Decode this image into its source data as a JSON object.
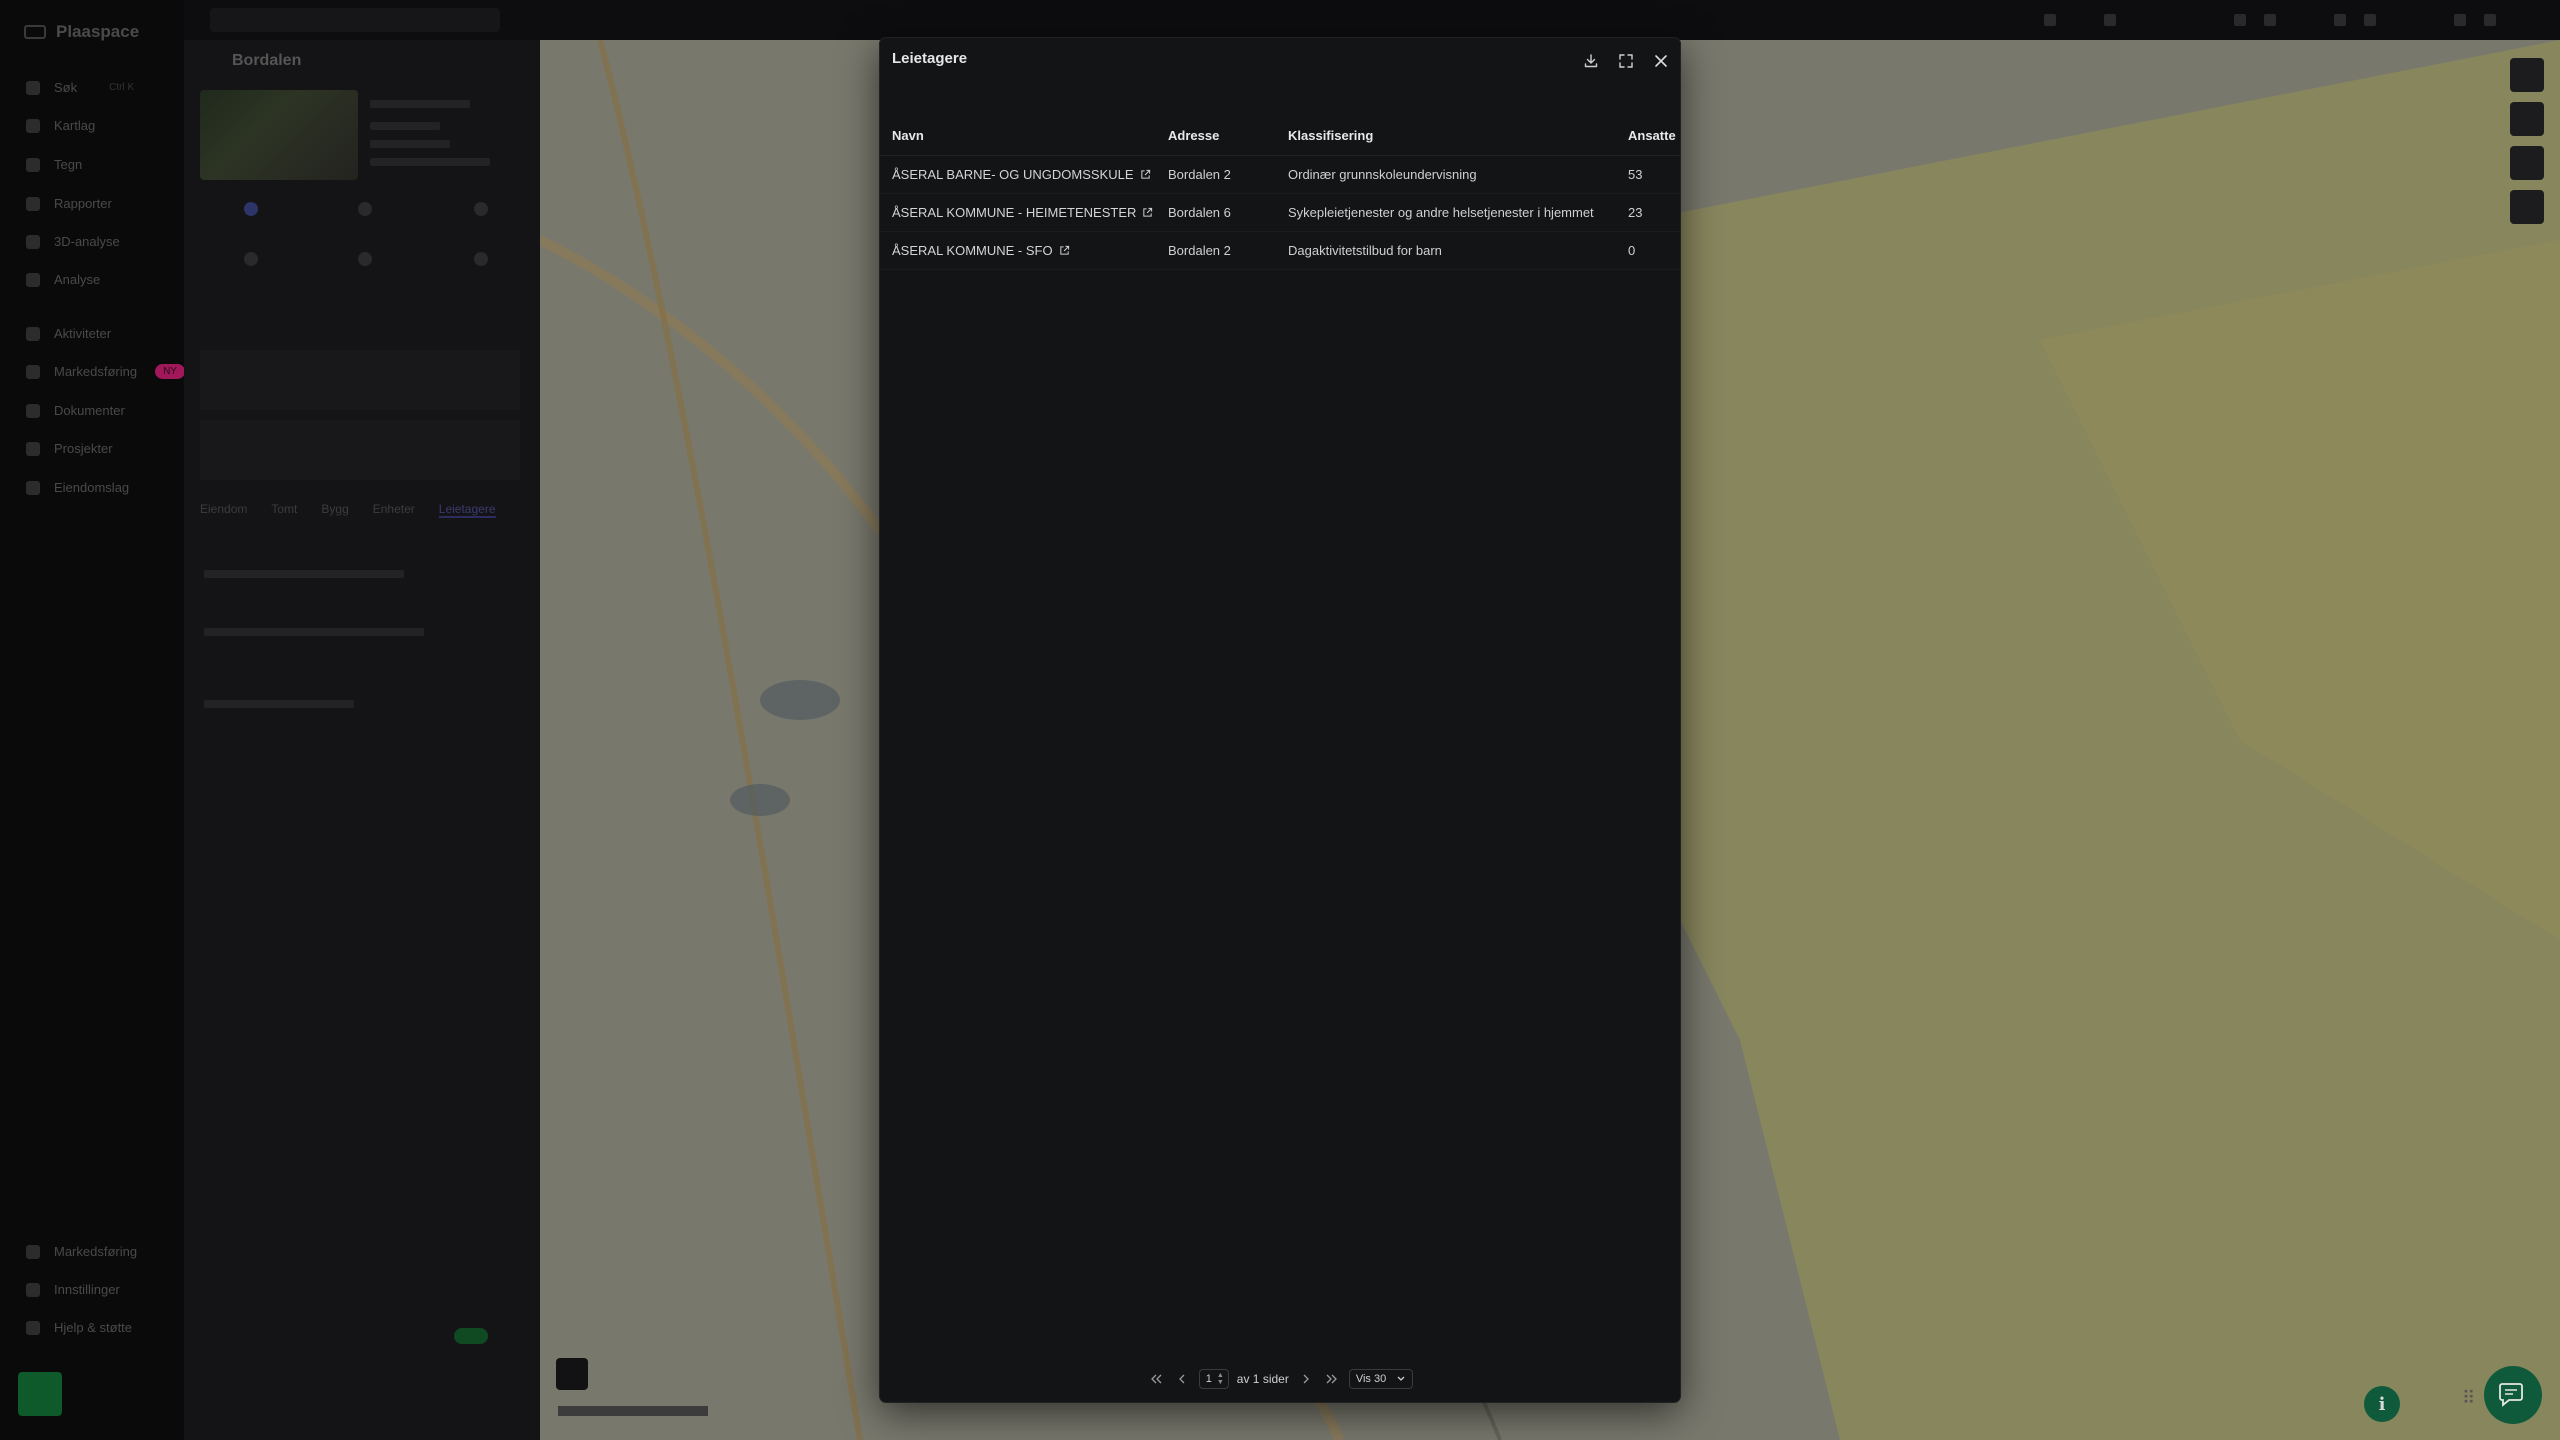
{
  "app": {
    "brand": "Plaaspace"
  },
  "sidebar": {
    "items": [
      {
        "label": "Søk",
        "shortcut": "Ctrl K"
      },
      {
        "label": "Kartlag"
      },
      {
        "label": "Tegn"
      },
      {
        "label": "Rapporter"
      },
      {
        "label": "3D-analyse"
      },
      {
        "label": "Analyse"
      },
      {
        "label": "Aktiviteter"
      },
      {
        "label": "Markedsføring",
        "badge": "NY"
      },
      {
        "label": "Dokumenter"
      },
      {
        "label": "Prosjekter"
      },
      {
        "label": "Eiendomslag"
      }
    ],
    "bottom_items": [
      {
        "label": "Markedsføring"
      },
      {
        "label": "Innstillinger"
      },
      {
        "label": "Hjelp & støtte"
      }
    ]
  },
  "panel": {
    "title": "Bordalen",
    "tabs": [
      "Eiendom",
      "Tomt",
      "Bygg",
      "Enheter",
      "Leietagere"
    ]
  },
  "modal": {
    "title": "Leietagere",
    "columns": [
      "Navn",
      "Adresse",
      "Klassifisering",
      "Ansatte"
    ],
    "rows": [
      {
        "name": "ÅSERAL BARNE- OG UNGDOMSSKULE",
        "address": "Bordalen 2",
        "classification": "Ordinær grunnskoleundervisning",
        "employees": "53"
      },
      {
        "name": "ÅSERAL KOMMUNE - HEIMETENESTER",
        "address": "Bordalen 6",
        "classification": "Sykepleietjenester og andre helsetjenester i hjemmet",
        "employees": "23"
      },
      {
        "name": "ÅSERAL KOMMUNE - SFO",
        "address": "Bordalen 2",
        "classification": "Dagaktivitetstilbud for barn",
        "employees": "0"
      }
    ],
    "pagination": {
      "page": "1",
      "of_text": "av 1 sider",
      "per_page": "Vis 30"
    }
  },
  "icons": {
    "download": "download-icon",
    "fullscreen": "fullscreen-icon",
    "close": "close-icon",
    "external": "external-link-icon",
    "info": "info-icon",
    "chat": "chat-icon"
  },
  "colors": {
    "modal_bg": "#131416",
    "accent_green": "#0f5a3a",
    "map_green": "#5fa56a"
  }
}
